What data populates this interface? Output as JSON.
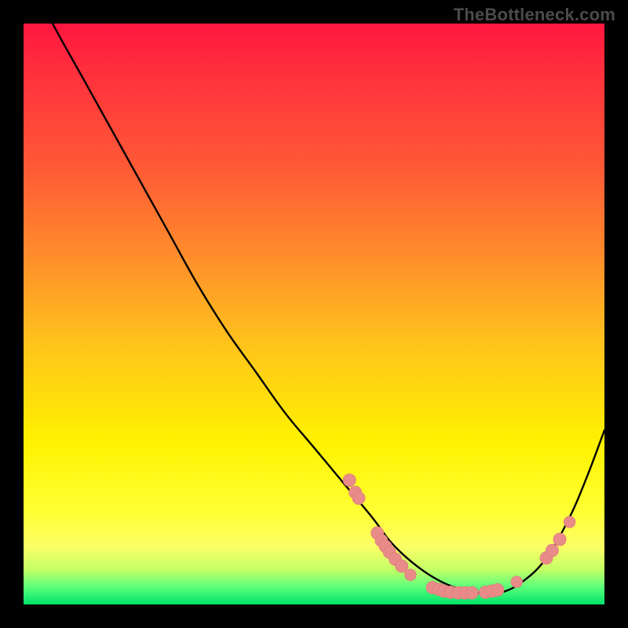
{
  "watermark": "TheBottleneck.com",
  "colors": {
    "page_bg": "#000000",
    "curve": "#000000",
    "marker_fill": "#e98b88",
    "marker_stroke": "#d97b78",
    "gradient_top": "#ff163f",
    "gradient_bottom": "#00e36a"
  },
  "chart_data": {
    "type": "line",
    "title": "",
    "xlabel": "",
    "ylabel": "",
    "xlim": [
      0,
      100
    ],
    "ylim": [
      0,
      100
    ],
    "series": [
      {
        "name": "bottleneck-curve",
        "x": [
          0,
          5,
          10,
          15,
          20,
          25,
          30,
          35,
          40,
          45,
          50,
          55,
          60,
          63,
          66,
          70,
          74,
          78,
          82,
          86,
          90,
          94,
          97,
          100
        ],
        "values": [
          110,
          100,
          91,
          82,
          73,
          64,
          55,
          47,
          40,
          33,
          27,
          21,
          15,
          11,
          8,
          5,
          3,
          2,
          2,
          4,
          8,
          15,
          22,
          30
        ]
      }
    ],
    "markers": [
      {
        "x": 56.1,
        "y": 21.4,
        "r": 1.1
      },
      {
        "x": 57.1,
        "y": 19.3,
        "r": 1.1
      },
      {
        "x": 57.7,
        "y": 18.3,
        "r": 1.1
      },
      {
        "x": 60.9,
        "y": 12.3,
        "r": 1.1
      },
      {
        "x": 61.6,
        "y": 11.0,
        "r": 1.1
      },
      {
        "x": 62.3,
        "y": 10.0,
        "r": 1.1
      },
      {
        "x": 63.0,
        "y": 9.0,
        "r": 1.1
      },
      {
        "x": 64.0,
        "y": 7.8,
        "r": 1.1
      },
      {
        "x": 65.1,
        "y": 6.6,
        "r": 1.1
      },
      {
        "x": 66.6,
        "y": 5.1,
        "r": 1.0
      },
      {
        "x": 70.4,
        "y": 2.9,
        "r": 1.1
      },
      {
        "x": 71.5,
        "y": 2.6,
        "r": 1.1
      },
      {
        "x": 72.4,
        "y": 2.3,
        "r": 1.1
      },
      {
        "x": 73.5,
        "y": 2.1,
        "r": 1.1
      },
      {
        "x": 74.8,
        "y": 2.0,
        "r": 1.1
      },
      {
        "x": 76.0,
        "y": 2.0,
        "r": 1.1
      },
      {
        "x": 77.2,
        "y": 2.0,
        "r": 1.1
      },
      {
        "x": 79.5,
        "y": 2.1,
        "r": 1.1
      },
      {
        "x": 80.6,
        "y": 2.3,
        "r": 1.1
      },
      {
        "x": 81.6,
        "y": 2.5,
        "r": 1.1
      },
      {
        "x": 84.9,
        "y": 3.9,
        "r": 1.0
      },
      {
        "x": 90.0,
        "y": 8.0,
        "r": 1.1
      },
      {
        "x": 91.0,
        "y": 9.3,
        "r": 1.1
      },
      {
        "x": 92.3,
        "y": 11.2,
        "r": 1.1
      },
      {
        "x": 94.0,
        "y": 14.2,
        "r": 1.0
      }
    ]
  }
}
